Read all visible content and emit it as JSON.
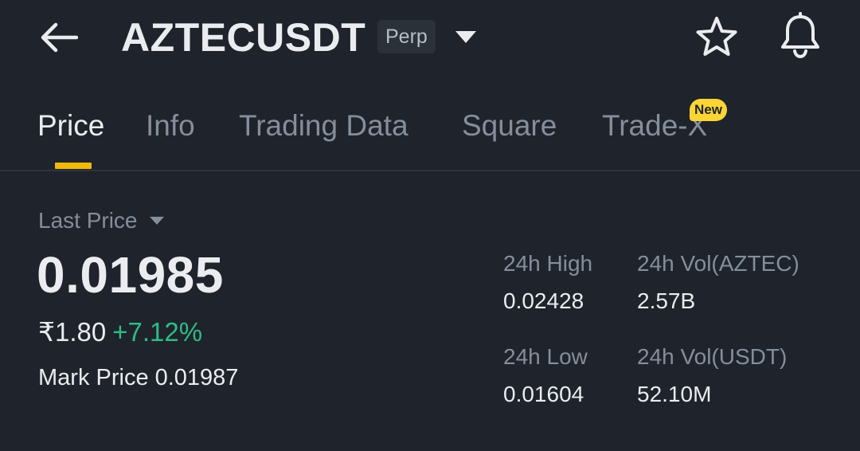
{
  "header": {
    "title": "AZTECUSDT",
    "badge": "Perp",
    "icons": [
      "back-arrow-icon",
      "caret-down-icon",
      "star-icon",
      "bell-icon"
    ]
  },
  "tabs": [
    {
      "label": "Price",
      "active": true
    },
    {
      "label": "Info",
      "active": false
    },
    {
      "label": "Trading Data",
      "active": false
    },
    {
      "label": "Square",
      "active": false
    },
    {
      "label": "Trade-X",
      "active": false,
      "badge": "New"
    }
  ],
  "price": {
    "label": "Last Price",
    "last": "0.01985",
    "fiat": "₹1.80",
    "change": "+7.12%",
    "mark_label": "Mark Price",
    "mark_value": "0.01987"
  },
  "stats": {
    "high_label": "24h High",
    "high_value": "0.02428",
    "low_label": "24h Low",
    "low_value": "0.01604",
    "vol_base_label": "24h Vol(AZTEC)",
    "vol_base_value": "2.57B",
    "vol_quote_label": "24h Vol(USDT)",
    "vol_quote_value": "52.10M"
  },
  "colors": {
    "background": "#1f232b",
    "accent": "#f0b90b",
    "positive": "#2ebd85",
    "muted": "#848e9c",
    "text": "#eaecef"
  }
}
